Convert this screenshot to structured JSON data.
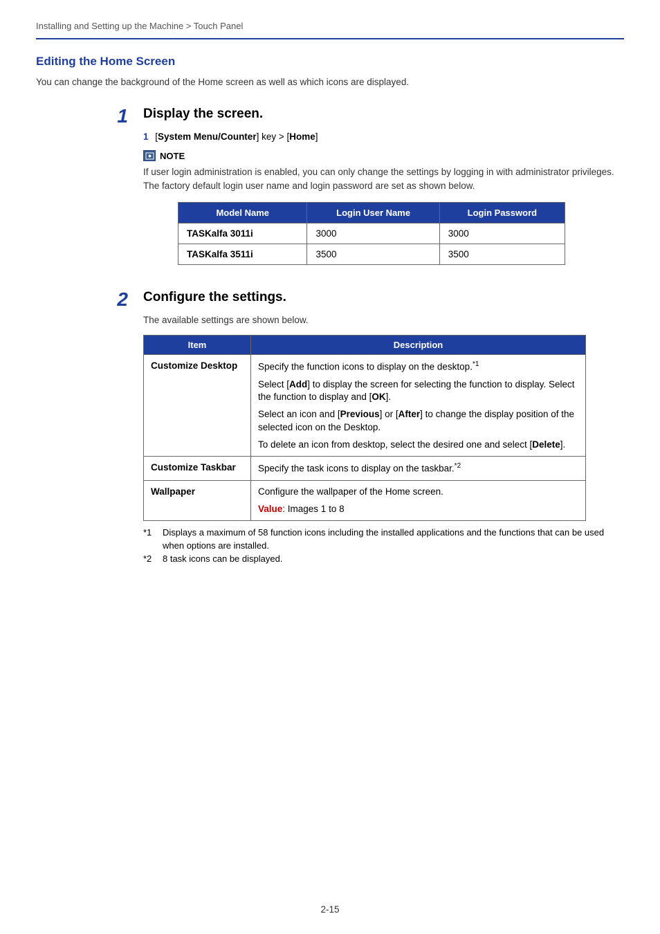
{
  "breadcrumb": "Installing and Setting up the Machine > Touch Panel",
  "section_title": "Editing the Home Screen",
  "intro": "You can change the background of the Home screen as well as which icons are displayed.",
  "step1": {
    "number": "1",
    "heading": "Display the screen.",
    "sub_number": "1",
    "sub_prefix": "[",
    "sub_bold1": "System Menu/Counter",
    "sub_middle": "] key > [",
    "sub_bold2": "Home",
    "sub_suffix": "]",
    "note_label": "NOTE",
    "note_text": "If user login administration is enabled, you can only change the settings by logging in with administrator privileges. The factory default login user name and login password are set as shown below.",
    "table": {
      "headers": [
        "Model Name",
        "Login User Name",
        "Login Password"
      ],
      "rows": [
        [
          "TASKalfa 3011i",
          "3000",
          "3000"
        ],
        [
          "TASKalfa 3511i",
          "3500",
          "3500"
        ]
      ]
    }
  },
  "step2": {
    "number": "2",
    "heading": "Configure the settings.",
    "intro": "The available settings are shown below.",
    "table": {
      "headers": [
        "Item",
        "Description"
      ],
      "rows": [
        {
          "item": "Customize Desktop",
          "desc": {
            "p1": "Specify the function icons to display on the desktop.",
            "p1_sup": "*1",
            "p2a": "Select [",
            "p2b": "Add",
            "p2c": "] to display the screen for selecting the function to display. Select the function to display and [",
            "p2d": "OK",
            "p2e": "].",
            "p3a": "Select an icon and [",
            "p3b": "Previous",
            "p3c": "] or [",
            "p3d": "After",
            "p3e": "] to change the display position of the selected icon on the Desktop.",
            "p4a": "To delete an icon from desktop, select the desired one and select [",
            "p4b": "Delete",
            "p4c": "]."
          }
        },
        {
          "item": "Customize Taskbar",
          "desc": {
            "p1": "Specify the task icons to display on the taskbar.",
            "p1_sup": "*2"
          }
        },
        {
          "item": "Wallpaper",
          "desc": {
            "p1": "Configure the wallpaper of the Home screen.",
            "value_label": "Value",
            "value_text": ": Images 1 to 8"
          }
        }
      ]
    },
    "footnotes": [
      {
        "num": "*1",
        "text": "Displays a maximum of 58 function icons including the installed applications and the functions that can be used when options are installed."
      },
      {
        "num": "*2",
        "text": "8 task icons can be displayed."
      }
    ]
  },
  "page_number": "2-15"
}
